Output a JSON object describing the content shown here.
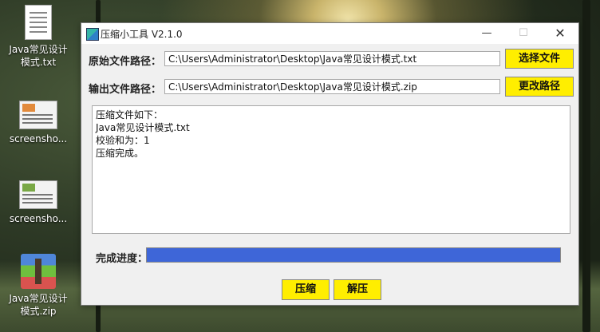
{
  "desktop": {
    "icons": [
      {
        "label": "Java常见设计模式.txt",
        "type": "text-file-icon"
      },
      {
        "label": "screensho...",
        "type": "image-file-icon"
      },
      {
        "label": "screensho...",
        "type": "image-file-icon"
      },
      {
        "label": "Java常见设计模式.zip",
        "type": "zip-archive-icon"
      }
    ]
  },
  "window": {
    "title": "压缩小工具  V2.1.0",
    "controls": {
      "minimize": "—",
      "maximize": "☐",
      "close": "✕"
    }
  },
  "form": {
    "source_label": "原始文件路径：",
    "source_value": "C:\\Users\\Administrator\\Desktop\\Java常见设计模式.txt",
    "select_button": "选择文件",
    "output_label": "输出文件路径：",
    "output_value": "C:\\Users\\Administrator\\Desktop\\Java常见设计模式.zip",
    "change_button": "更改路径"
  },
  "log": {
    "lines": [
      "压缩文件如下：",
      "Java常见设计模式.txt",
      "校验和为：1",
      "压缩完成。"
    ]
  },
  "progress": {
    "label": "完成进度：",
    "value": 1.0,
    "color": "#3e66d8"
  },
  "actions": {
    "compress": "压缩",
    "decompress": "解压"
  },
  "colors": {
    "button_yellow": "#ffee00"
  }
}
